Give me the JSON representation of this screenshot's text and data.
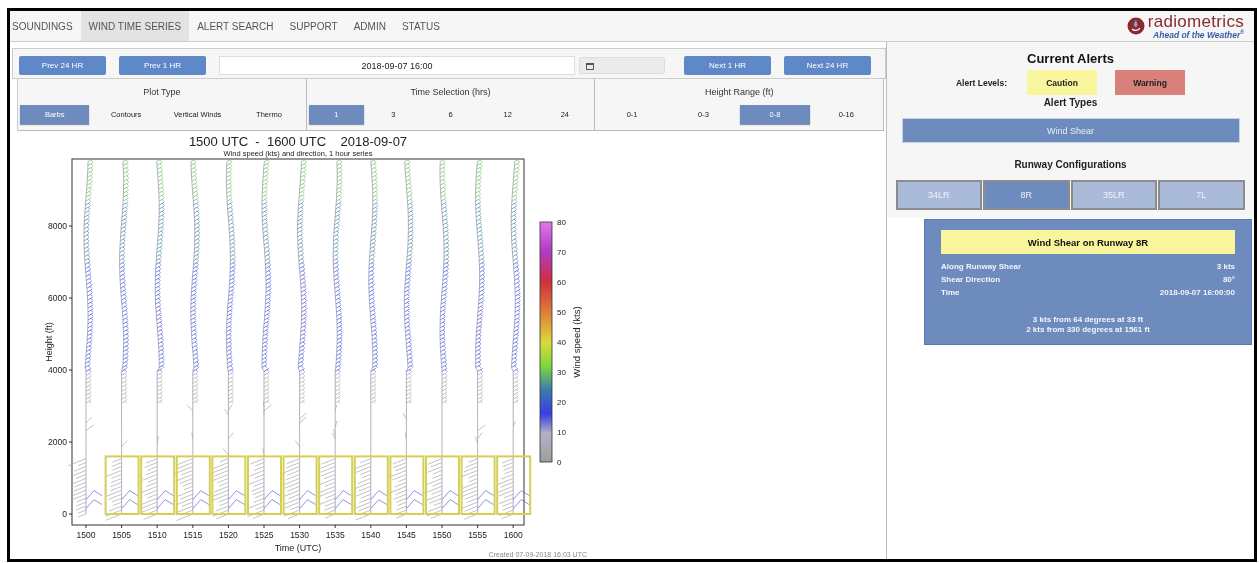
{
  "nav": {
    "tabs": [
      {
        "label": "SOUNDINGS",
        "selected": false
      },
      {
        "label": "WIND TIME SERIES",
        "selected": true
      },
      {
        "label": "ALERT SEARCH",
        "selected": false
      },
      {
        "label": "SUPPORT",
        "selected": false
      },
      {
        "label": "ADMIN",
        "selected": false
      },
      {
        "label": "STATUS",
        "selected": false
      }
    ],
    "logo": {
      "name": "radiometrics",
      "tagline": "Ahead of the Weather",
      "mark": "®"
    }
  },
  "controls": {
    "prev_buttons": [
      "Prev 24 HR",
      "Prev 1 HR"
    ],
    "datetime": "2018-09-07 16:00",
    "next_buttons": [
      "Next 1 HR",
      "Next 24 HR"
    ]
  },
  "option_groups": [
    {
      "title": "Plot Type",
      "options": [
        {
          "label": "Barbs",
          "selected": true
        },
        {
          "label": "Contours",
          "selected": false
        },
        {
          "label": "Vertical Winds",
          "selected": false
        },
        {
          "label": "Thermo",
          "selected": false
        }
      ]
    },
    {
      "title": "Time Selection (hrs)",
      "options": [
        {
          "label": "1",
          "selected": true
        },
        {
          "label": "3",
          "selected": false
        },
        {
          "label": "6",
          "selected": false
        },
        {
          "label": "12",
          "selected": false
        },
        {
          "label": "24",
          "selected": false
        }
      ]
    },
    {
      "title": "Height Range (ft)",
      "options": [
        {
          "label": "0-1",
          "selected": false
        },
        {
          "label": "0-3",
          "selected": false
        },
        {
          "label": "0-8",
          "selected": true
        },
        {
          "label": "0-16",
          "selected": false
        }
      ]
    }
  ],
  "plot": {
    "title": "1500 UTC  -  1600 UTC    2018-09-07",
    "subtitle": "Wind speed (kts) and direction, 1 hour series",
    "ylabel": "Height (ft)",
    "xlabel": "Time (UTC)",
    "yticks": [
      "8000",
      "6000",
      "4000",
      "2000",
      "0"
    ],
    "xticks": [
      {
        "label": "1500",
        "highlighted": false
      },
      {
        "label": "1505",
        "highlighted": true
      },
      {
        "label": "1510",
        "highlighted": true
      },
      {
        "label": "1515",
        "highlighted": true
      },
      {
        "label": "1520",
        "highlighted": true
      },
      {
        "label": "1525",
        "highlighted": true
      },
      {
        "label": "1530",
        "highlighted": true
      },
      {
        "label": "1535",
        "highlighted": true
      },
      {
        "label": "1540",
        "highlighted": true
      },
      {
        "label": "1545",
        "highlighted": true
      },
      {
        "label": "1550",
        "highlighted": true
      },
      {
        "label": "1555",
        "highlighted": true
      },
      {
        "label": "1600",
        "highlighted": true
      }
    ],
    "colorbar_label": "Wind speed (kts)",
    "colorbar_ticks": [
      "80",
      "70",
      "60",
      "50",
      "40",
      "30",
      "20",
      "10",
      "0"
    ],
    "created": "Created 07-09-2018 16:03 UTC"
  },
  "alerts": {
    "title": "Current Alerts",
    "levels_label": "Alert Levels:",
    "levels": [
      {
        "label": "Caution",
        "color": "#f8f59c"
      },
      {
        "label": "Warning",
        "color": "#d8807a"
      }
    ],
    "types_title": "Alert Types",
    "types": [
      {
        "label": "Wind Shear",
        "selected": true
      }
    ],
    "runway_title": "Runway Configurations",
    "runways": [
      {
        "label": "34LR",
        "selected": false
      },
      {
        "label": "8R",
        "selected": true
      },
      {
        "label": "35LR",
        "selected": false
      },
      {
        "label": "7L",
        "selected": false
      }
    ],
    "card": {
      "title": "Wind Shear on Runway 8R",
      "rows": [
        {
          "label": "Along Runway Shear",
          "value": "3 kts"
        },
        {
          "label": "Shear Direction",
          "value": "80°"
        },
        {
          "label": "Time",
          "value": "2018-09-07 16:00:00"
        }
      ],
      "messages": [
        "3 kts from 64 degrees at 33 ft",
        "2 kts from 330 degrees at 1561 ft"
      ]
    }
  }
}
